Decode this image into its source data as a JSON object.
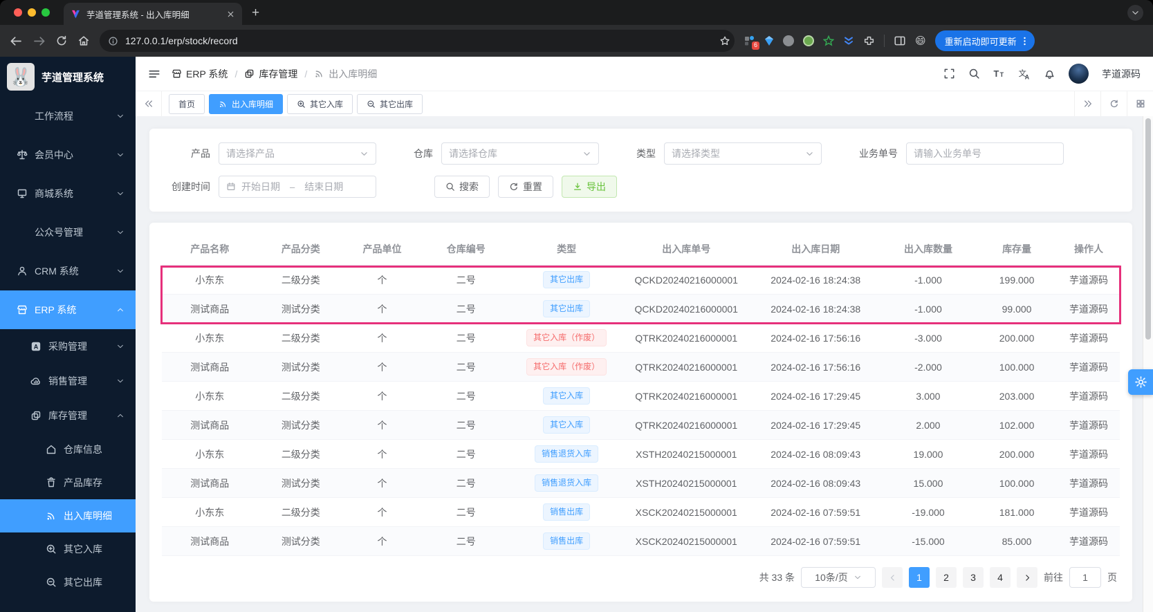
{
  "browser": {
    "tab_title": "芋道管理系统 - 出入库明细",
    "url": "127.0.0.1/erp/stock/record",
    "update_button_label": "重新启动即可更新",
    "extension_badge_count": "6"
  },
  "sidebar": {
    "app_title": "芋道管理系统",
    "menu": [
      {
        "id": "workflow",
        "label": "工作流程",
        "level": 0,
        "chevron": "down"
      },
      {
        "id": "member-center",
        "label": "会员中心",
        "icon": "scale",
        "level": 0,
        "chevron": "down"
      },
      {
        "id": "mall-system",
        "label": "商城系统",
        "icon": "monitor",
        "level": 0,
        "chevron": "down"
      },
      {
        "id": "mp-admin",
        "label": "公众号管理",
        "level": 0,
        "chevron": "down"
      },
      {
        "id": "crm-system",
        "label": "CRM 系统",
        "icon": "user",
        "level": 0,
        "chevron": "down"
      },
      {
        "id": "erp-system",
        "label": "ERP 系统",
        "icon": "shop",
        "level": 0,
        "chevron": "up",
        "active": true
      },
      {
        "id": "purchase",
        "label": "采购管理",
        "icon": "letterA",
        "level": 1,
        "chevron": "down"
      },
      {
        "id": "sales",
        "label": "销售管理",
        "icon": "cloud",
        "level": 1,
        "chevron": "down"
      },
      {
        "id": "stock",
        "label": "库存管理",
        "icon": "boxes",
        "level": 1,
        "chevron": "up"
      },
      {
        "id": "warehouse-info",
        "label": "仓库信息",
        "icon": "home",
        "level": 2
      },
      {
        "id": "product-stock",
        "label": "产品库存",
        "icon": "cup",
        "level": 2
      },
      {
        "id": "stock-record",
        "label": "出入库明细",
        "icon": "signal",
        "level": 2,
        "active": true
      },
      {
        "id": "other-in",
        "label": "其它入库",
        "icon": "zoomin",
        "level": 2
      },
      {
        "id": "other-out",
        "label": "其它出库",
        "icon": "zoomout",
        "level": 2
      }
    ]
  },
  "header": {
    "breadcrumb": [
      {
        "label": "ERP 系统",
        "icon": "shop"
      },
      {
        "label": "库存管理",
        "icon": "boxes"
      },
      {
        "label": "出入库明细",
        "icon": "signal"
      }
    ],
    "username": "芋道源码"
  },
  "tags": [
    {
      "id": "home",
      "label": "首页"
    },
    {
      "id": "stock-record",
      "label": "出入库明细",
      "icon": "signal",
      "active": true
    },
    {
      "id": "other-in",
      "label": "其它入库",
      "icon": "zoomin"
    },
    {
      "id": "other-out",
      "label": "其它出库",
      "icon": "zoomout"
    }
  ],
  "filters": {
    "product_label": "产品",
    "product_placeholder": "请选择产品",
    "warehouse_label": "仓库",
    "warehouse_placeholder": "请选择仓库",
    "type_label": "类型",
    "type_placeholder": "请选择类型",
    "bizno_label": "业务单号",
    "bizno_placeholder": "请输入业务单号",
    "time_label": "创建时间",
    "start_placeholder": "开始日期",
    "range_separator": "–",
    "end_placeholder": "结束日期",
    "search_label": "搜索",
    "reset_label": "重置",
    "export_label": "导出"
  },
  "table": {
    "columns": [
      "产品名称",
      "产品分类",
      "产品单位",
      "仓库编号",
      "类型",
      "出入库单号",
      "出入库日期",
      "出入库数量",
      "库存量",
      "操作人"
    ],
    "highlight_rows": [
      0,
      1
    ],
    "highlight_color": "#e6307b",
    "rows": [
      {
        "product": "小东东",
        "category": "二级分类",
        "unit": "个",
        "warehouse": "二号",
        "type": "其它出库",
        "type_style": "blue",
        "order_no": "QCKD20240216000001",
        "datetime": "2024-02-16 18:24:38",
        "quantity": "-1.000",
        "stock": "199.000",
        "operator": "芋道源码"
      },
      {
        "product": "测试商品",
        "category": "测试分类",
        "unit": "个",
        "warehouse": "二号",
        "type": "其它出库",
        "type_style": "blue",
        "order_no": "QCKD20240216000001",
        "datetime": "2024-02-16 18:24:38",
        "quantity": "-1.000",
        "stock": "99.000",
        "operator": "芋道源码"
      },
      {
        "product": "小东东",
        "category": "二级分类",
        "unit": "个",
        "warehouse": "二号",
        "type": "其它入库（作废）",
        "type_style": "red",
        "order_no": "QTRK20240216000001",
        "datetime": "2024-02-16 17:56:16",
        "quantity": "-3.000",
        "stock": "200.000",
        "operator": "芋道源码"
      },
      {
        "product": "测试商品",
        "category": "测试分类",
        "unit": "个",
        "warehouse": "二号",
        "type": "其它入库（作废）",
        "type_style": "red",
        "order_no": "QTRK20240216000001",
        "datetime": "2024-02-16 17:56:16",
        "quantity": "-2.000",
        "stock": "100.000",
        "operator": "芋道源码"
      },
      {
        "product": "小东东",
        "category": "二级分类",
        "unit": "个",
        "warehouse": "二号",
        "type": "其它入库",
        "type_style": "blue",
        "order_no": "QTRK20240216000001",
        "datetime": "2024-02-16 17:29:45",
        "quantity": "3.000",
        "stock": "203.000",
        "operator": "芋道源码"
      },
      {
        "product": "测试商品",
        "category": "测试分类",
        "unit": "个",
        "warehouse": "二号",
        "type": "其它入库",
        "type_style": "blue",
        "order_no": "QTRK20240216000001",
        "datetime": "2024-02-16 17:29:45",
        "quantity": "2.000",
        "stock": "102.000",
        "operator": "芋道源码"
      },
      {
        "product": "小东东",
        "category": "二级分类",
        "unit": "个",
        "warehouse": "二号",
        "type": "销售退货入库",
        "type_style": "blue",
        "order_no": "XSTH20240215000001",
        "datetime": "2024-02-16 08:09:43",
        "quantity": "19.000",
        "stock": "200.000",
        "operator": "芋道源码"
      },
      {
        "product": "测试商品",
        "category": "测试分类",
        "unit": "个",
        "warehouse": "二号",
        "type": "销售退货入库",
        "type_style": "blue",
        "order_no": "XSTH20240215000001",
        "datetime": "2024-02-16 08:09:43",
        "quantity": "15.000",
        "stock": "100.000",
        "operator": "芋道源码"
      },
      {
        "product": "小东东",
        "category": "二级分类",
        "unit": "个",
        "warehouse": "二号",
        "type": "销售出库",
        "type_style": "blue",
        "order_no": "XSCK20240215000001",
        "datetime": "2024-02-16 07:59:51",
        "quantity": "-19.000",
        "stock": "181.000",
        "operator": "芋道源码"
      },
      {
        "product": "测试商品",
        "category": "测试分类",
        "unit": "个",
        "warehouse": "二号",
        "type": "销售出库",
        "type_style": "blue",
        "order_no": "XSCK20240215000001",
        "datetime": "2024-02-16 07:59:51",
        "quantity": "-15.000",
        "stock": "85.000",
        "operator": "芋道源码"
      }
    ]
  },
  "pagination": {
    "total_label": "共 33 条",
    "page_size_label": "10条/页",
    "pages": [
      "1",
      "2",
      "3",
      "4"
    ],
    "active_page": "1",
    "goto_label": "前往",
    "goto_value": "1",
    "goto_unit": "页"
  },
  "colors": {
    "accent": "#409eff",
    "badge_blue": "#409eff",
    "badge_red": "#f56c6c",
    "highlight_pink": "#e6307b",
    "export_green": "#67c23a"
  }
}
